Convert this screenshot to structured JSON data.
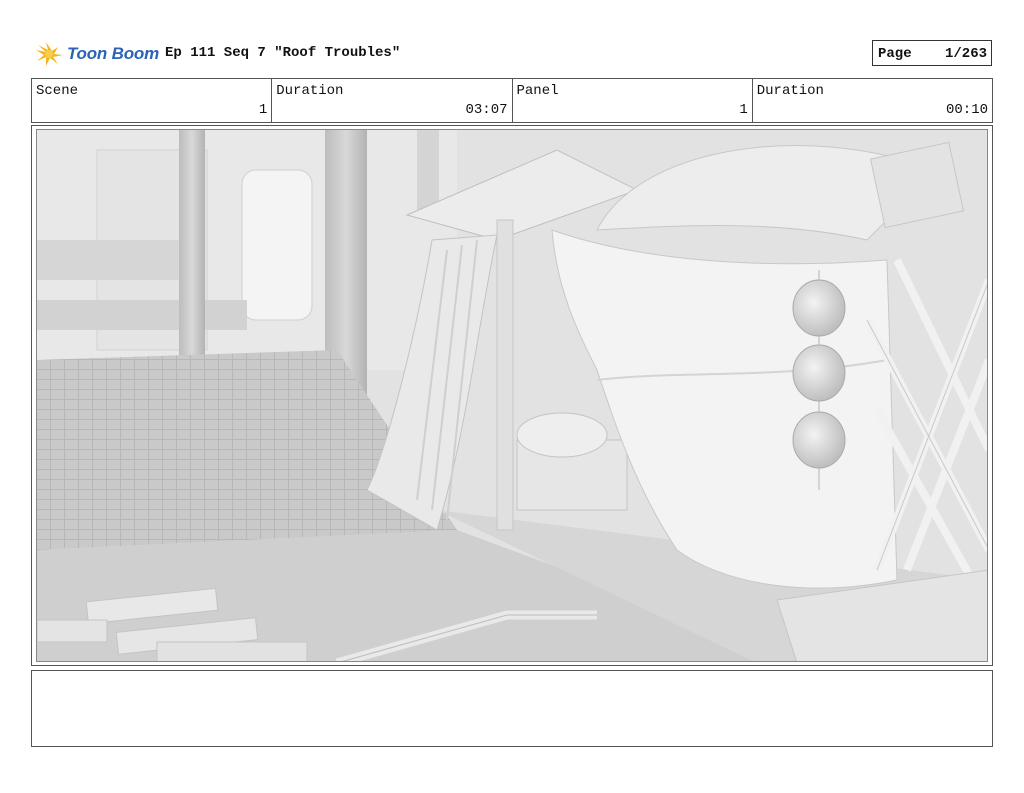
{
  "header": {
    "logo_text": "Toon Boom",
    "title": "Ep 111 Seq 7 \"Roof Troubles\"",
    "page_label": "Page",
    "page_value": "1/263"
  },
  "info": {
    "scene_label": "Scene",
    "scene_value": "1",
    "scene_duration_label": "Duration",
    "scene_duration_value": "03:07",
    "panel_label": "Panel",
    "panel_value": "1",
    "panel_duration_label": "Duration",
    "panel_duration_value": "00:10"
  },
  "panel": {
    "image_name": "rooftop-tent-scene-render"
  },
  "caption": {
    "text": ""
  },
  "colors": {
    "brand_blue": "#2a63b8",
    "brand_yellow": "#f2b51d",
    "render_gray": "#dcdcdc"
  }
}
